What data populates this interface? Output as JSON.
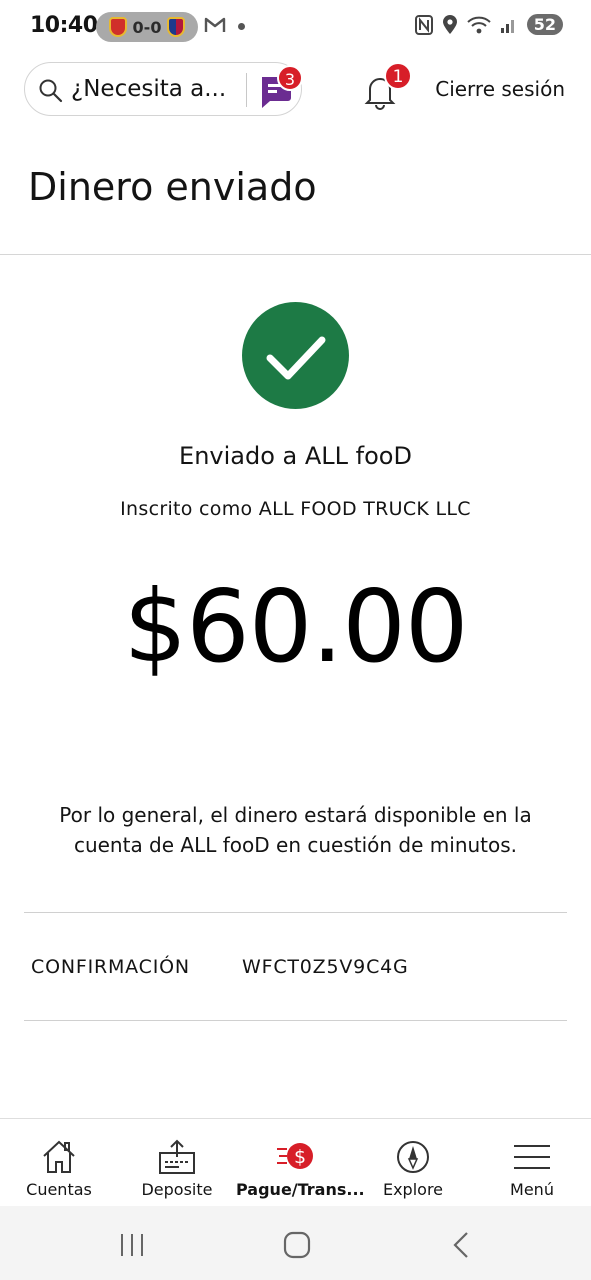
{
  "status_bar": {
    "time": "10:40",
    "score": "0-0",
    "battery": "52"
  },
  "header": {
    "search_placeholder": "¿Necesita a...",
    "chat_badge": "3",
    "bell_badge": "1",
    "logout_label": "Cierre sesión"
  },
  "page": {
    "title": "Dinero enviado",
    "sent_to": "Enviado a ALL fooD",
    "enrolled_as": "Inscrito como ALL FOOD TRUCK LLC",
    "amount": "$60.00",
    "note": "Por lo general, el dinero estará disponible en la cuenta de ALL fooD en cuestión de minutos.",
    "confirmation_label": "CONFIRMACIÓN",
    "confirmation_value": "WFCT0Z5V9C4G"
  },
  "colors": {
    "success": "#1d7a45",
    "brand_red": "#d71e28",
    "chat_purple": "#6b2c91"
  },
  "bottom_nav": {
    "items": [
      {
        "label": "Cuentas",
        "icon": "home-icon"
      },
      {
        "label": "Deposite",
        "icon": "deposit-icon"
      },
      {
        "label": "Pague/Trans...",
        "icon": "pay-transfer-icon",
        "active": true
      },
      {
        "label": "Explore",
        "icon": "compass-icon"
      },
      {
        "label": "Menú",
        "icon": "hamburger-icon"
      }
    ]
  }
}
